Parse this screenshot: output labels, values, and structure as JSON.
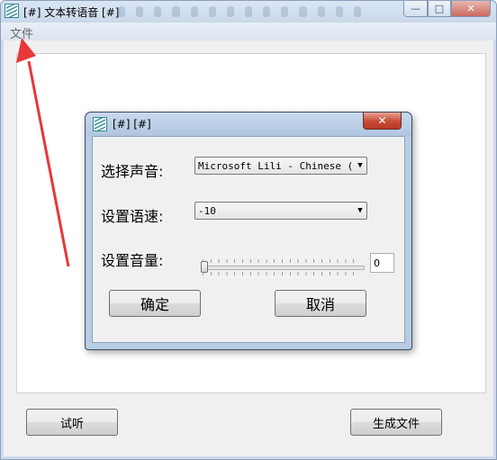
{
  "window": {
    "title": "[#] 文本转语音 [#]",
    "controls": {
      "minimize": "—",
      "maximize": "□",
      "close": "✕"
    }
  },
  "menu": {
    "file": "文件"
  },
  "buttons": {
    "listen": "试听",
    "generate": "生成文件"
  },
  "dialog": {
    "title": "[#]  [#]",
    "close": "✕",
    "voice_label": "选择声音:",
    "voice_value": "Microsoft Lili - Chinese (Ch",
    "rate_label": "设置语速:",
    "rate_value": "-10",
    "volume_label": "设置音量:",
    "volume_level": 0,
    "volume_value": "0",
    "ok_label": "确定",
    "cancel_label": "取消"
  },
  "icons": {
    "app": "app-logo-icon",
    "dropdown": "chevron-down-icon",
    "annotation": "red-arrow-icon"
  },
  "colors": {
    "titlebar": "#c9d8ea",
    "dialog_frame": "#b8cde4",
    "close_button": "#c84a35",
    "annotation_arrow": "#e8373a"
  }
}
